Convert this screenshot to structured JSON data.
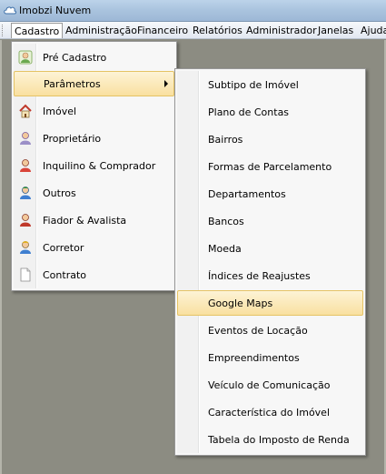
{
  "window": {
    "title": "Imobzi Nuvem",
    "icon": "cloud-icon"
  },
  "menubar": {
    "items": [
      {
        "label": "Cadastro",
        "active": true
      },
      {
        "label": "Administração"
      },
      {
        "label": "Financeiro"
      },
      {
        "label": "Relatórios"
      },
      {
        "label": "Administrador"
      },
      {
        "label": "Janelas"
      },
      {
        "label": "Ajuda"
      }
    ]
  },
  "cadastro_menu": {
    "items": [
      {
        "label": "Pré Cadastro",
        "icon": "person-green-icon"
      },
      {
        "label": "Parâmetros",
        "icon": "",
        "highlighted": true,
        "has_submenu": true
      },
      {
        "label": "Imóvel",
        "icon": "house-icon"
      },
      {
        "label": "Proprietário",
        "icon": "person-purple-icon"
      },
      {
        "label": "Inquilino & Comprador",
        "icon": "person-red-icon"
      },
      {
        "label": "Outros",
        "icon": "person-blue-icon"
      },
      {
        "label": "Fiador & Avalista",
        "icon": "person-red-icon"
      },
      {
        "label": "Corretor",
        "icon": "person-yellow-icon"
      },
      {
        "label": "Contrato",
        "icon": "document-icon"
      }
    ]
  },
  "parametros_menu": {
    "items": [
      {
        "label": "Subtipo de Imóvel"
      },
      {
        "label": "Plano de Contas"
      },
      {
        "label": "Bairros"
      },
      {
        "label": "Formas de Parcelamento"
      },
      {
        "label": "Departamentos"
      },
      {
        "label": "Bancos"
      },
      {
        "label": "Moeda"
      },
      {
        "label": "Índices de Reajustes"
      },
      {
        "label": "Google Maps",
        "highlighted": true
      },
      {
        "label": "Eventos de Locação"
      },
      {
        "label": "Empreendimentos"
      },
      {
        "label": "Veículo de Comunicação"
      },
      {
        "label": "Característica do Imóvel"
      },
      {
        "label": "Tabela do Imposto de Renda"
      }
    ]
  },
  "colors": {
    "highlight_top": "#fdf3d6",
    "highlight_bottom": "#f9e0a0",
    "workspace": "#8c8c82"
  }
}
